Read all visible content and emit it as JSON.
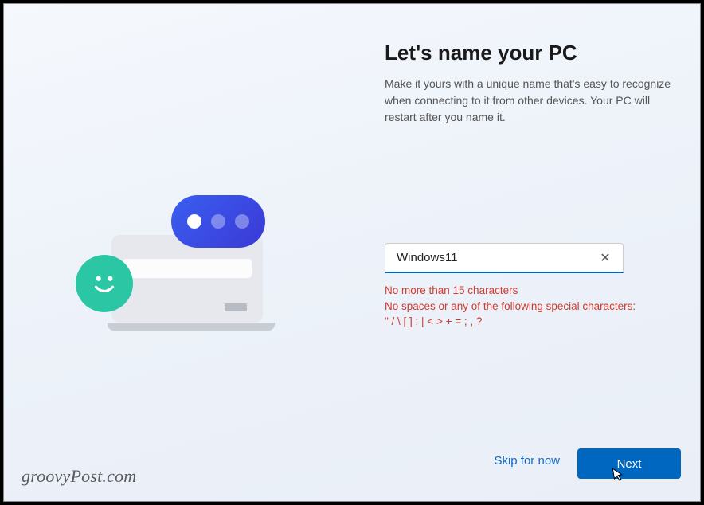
{
  "heading": "Let's name your PC",
  "subtext": "Make it yours with a unique name that's easy to recognize when connecting to it from other devices. Your PC will restart after you name it.",
  "input": {
    "value": "Windows11",
    "placeholder": ""
  },
  "validation": {
    "line1": "No more than 15 characters",
    "line2": "No spaces or any of the following special characters:",
    "line3": "\" / \\ [ ] : | < > + = ; , ?"
  },
  "actions": {
    "skip": "Skip for now",
    "next": "Next"
  },
  "watermark": "groovyPost.com",
  "icons": {
    "clear": "✕",
    "cursor": "↖"
  }
}
